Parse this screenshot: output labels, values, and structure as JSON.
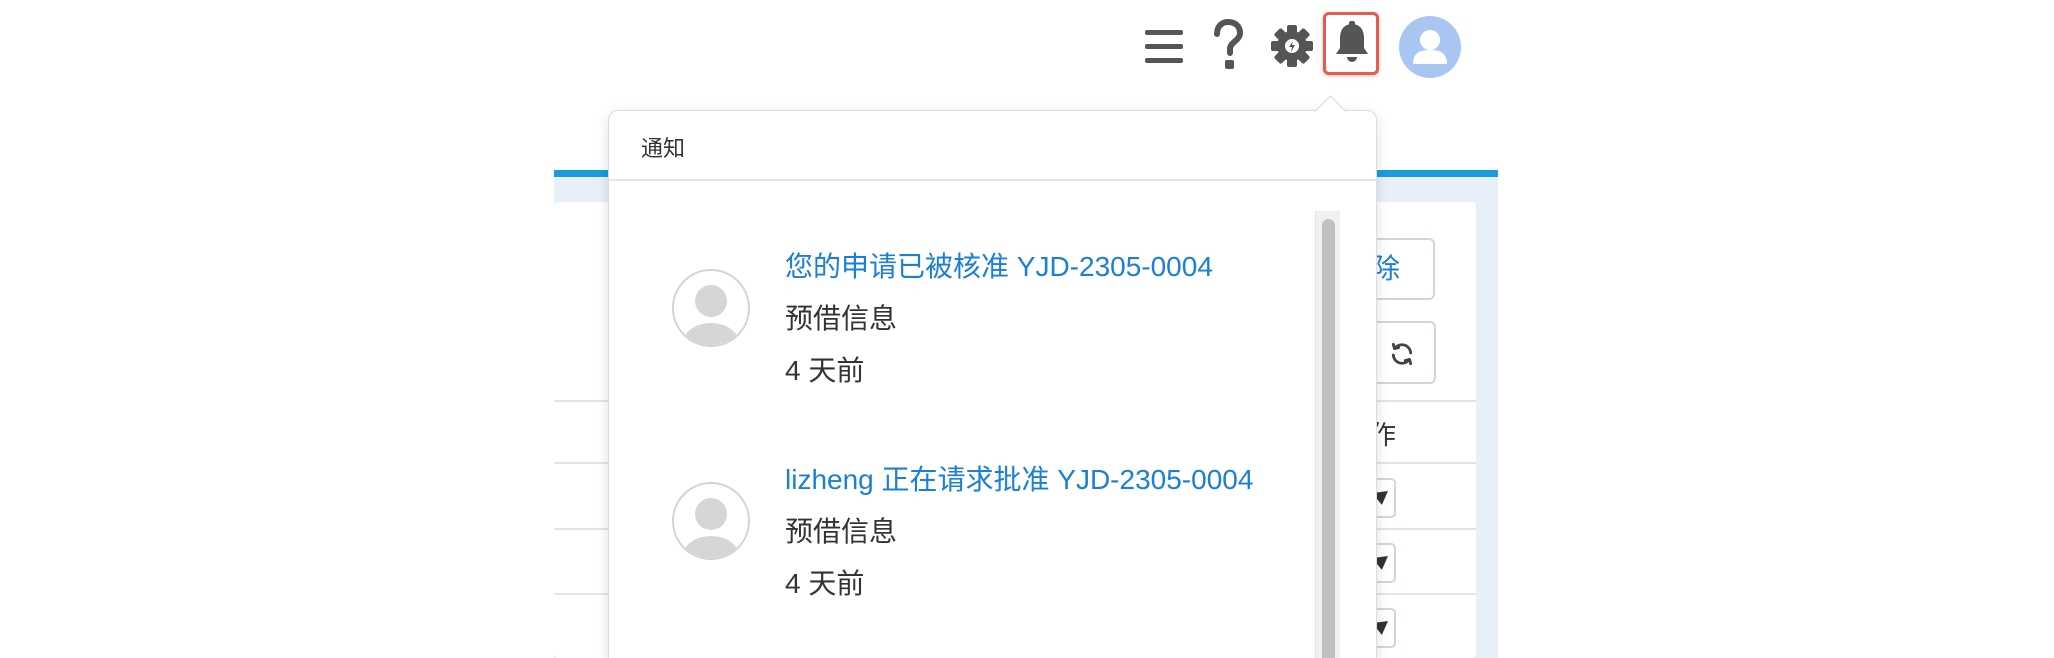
{
  "header": {
    "icons": [
      "menu-icon",
      "help-icon",
      "settings-icon",
      "notification-bell-icon",
      "user-avatar-icon"
    ],
    "help_glyph": "?",
    "colors": {
      "icon": "#555555",
      "bell_highlight": "#e35d4f",
      "avatar_bg": "#a9c6f2"
    }
  },
  "background_page": {
    "delete_button_label": "除",
    "action_column_header": "作",
    "colors": {
      "topbar": "#1a9bdb",
      "panel": "#e7eff9"
    }
  },
  "notifications_popover": {
    "title": "通知",
    "items": [
      {
        "title": "您的申请已被核准 YJD-2305-0004",
        "subtitle": "预借信息",
        "time": "4 天前"
      },
      {
        "title": "lizheng 正在请求批准 YJD-2305-0004",
        "subtitle": "预借信息",
        "time": "4 天前"
      }
    ],
    "colors": {
      "link": "#1a7fd8",
      "text": "#333333"
    }
  }
}
